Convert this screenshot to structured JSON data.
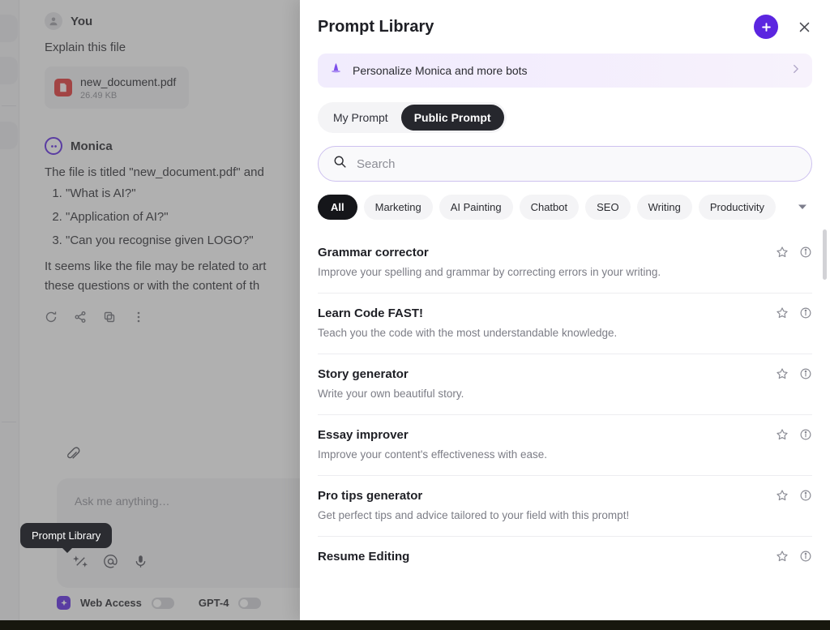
{
  "chat": {
    "user": {
      "sender": "You",
      "message": "Explain this file",
      "file": {
        "name": "new_document.pdf",
        "size": "26.49 KB",
        "type_label": "PDF"
      }
    },
    "assistant": {
      "sender": "Monica",
      "intro": "The file is titled \"new_document.pdf\" and",
      "list": [
        "\"What is AI?\"",
        "\"Application of AI?\"",
        "\"Can you recognise given LOGO?\""
      ],
      "tail_line_1": "It seems like the file may be related to art",
      "tail_line_2": "these questions or with the content of th"
    },
    "composer": {
      "placeholder": "Ask me anything…"
    },
    "footer": {
      "web_access_label": "Web Access",
      "model_label": "GPT-4"
    },
    "tooltip": "Prompt Library"
  },
  "panel": {
    "title": "Prompt Library",
    "promo": {
      "text": "Personalize Monica and more bots"
    },
    "tabs": [
      {
        "label": "My Prompt",
        "active": false
      },
      {
        "label": "Public Prompt",
        "active": true
      }
    ],
    "search": {
      "value": "",
      "placeholder": "Search"
    },
    "chips": [
      {
        "label": "All",
        "active": true
      },
      {
        "label": "Marketing",
        "active": false
      },
      {
        "label": "AI Painting",
        "active": false
      },
      {
        "label": "Chatbot",
        "active": false
      },
      {
        "label": "SEO",
        "active": false
      },
      {
        "label": "Writing",
        "active": false
      },
      {
        "label": "Productivity",
        "active": false
      }
    ],
    "prompts": [
      {
        "title": "Grammar corrector",
        "desc": "Improve your spelling and grammar by correcting errors in your writing."
      },
      {
        "title": "Learn Code FAST!",
        "desc": "Teach you the code with the most understandable knowledge."
      },
      {
        "title": "Story generator",
        "desc": "Write your own beautiful story."
      },
      {
        "title": "Essay improver",
        "desc": "Improve your content's effectiveness with ease."
      },
      {
        "title": "Pro tips generator",
        "desc": "Get perfect tips and advice tailored to your field with this prompt!"
      },
      {
        "title": "Resume Editing",
        "desc": ""
      }
    ]
  },
  "colors": {
    "accent": "#5b25e0",
    "tab_active_bg": "#26272d",
    "chip_active_bg": "#15161a",
    "pdf_red": "#e03232",
    "search_border": "#cdc1ef"
  }
}
